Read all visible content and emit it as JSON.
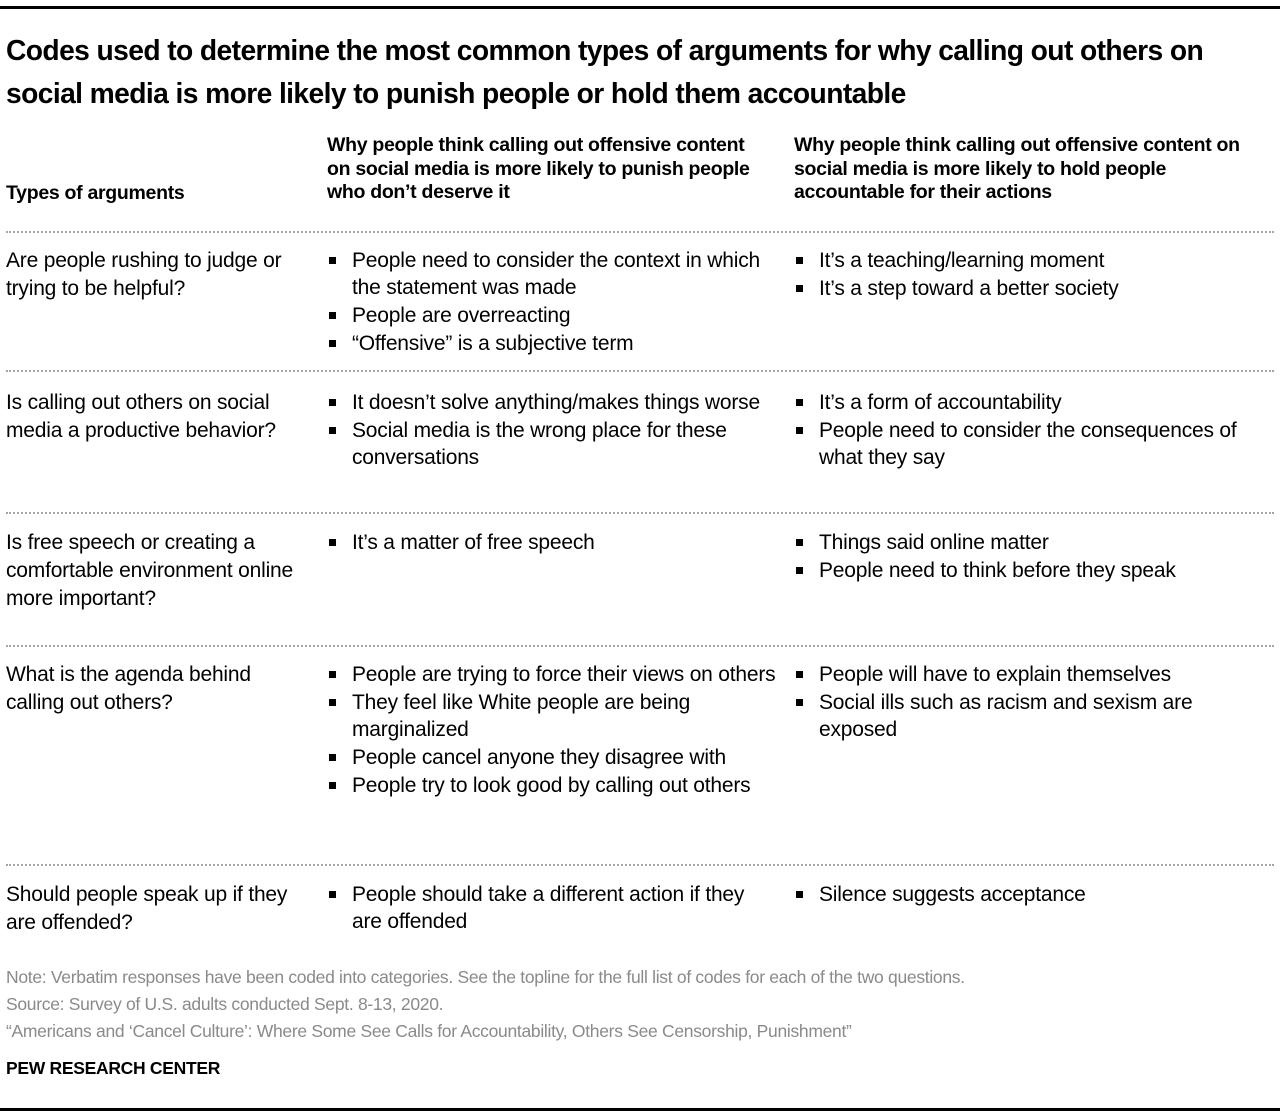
{
  "title": "Codes used to determine the most common types of arguments for why calling out others on social media is more likely to punish people or hold them accountable",
  "headers": {
    "types": "Types of arguments",
    "punish": "Why people think calling out offensive content on social media is more likely to punish people who don’t deserve it",
    "accountable": "Why people think calling out offensive content on social media is more likely to hold people accountable for their actions"
  },
  "rows": [
    {
      "type": "Are people rushing to judge or trying to be helpful?",
      "punish": [
        "People need to consider the context in which the statement was made",
        "People are overreacting",
        "“Offensive” is a subjective term"
      ],
      "accountable": [
        "It’s a teaching/learning moment",
        "It’s a step toward a better society"
      ]
    },
    {
      "type": "Is calling out others on social media a productive behavior?",
      "punish": [
        "It doesn’t solve anything/makes things worse",
        "Social media is the wrong place for these conversations"
      ],
      "accountable": [
        "It’s a form of accountability",
        "People need to consider the consequences of what they say"
      ]
    },
    {
      "type": "Is free speech or creating a comfortable environment online more important?",
      "punish": [
        "It’s a matter of free speech"
      ],
      "accountable": [
        "Things said online matter",
        "People need to think before they speak"
      ]
    },
    {
      "type": "What is the agenda behind calling out others?",
      "punish": [
        "People are trying to force their views on others",
        "They feel like White people are being marginalized",
        "People cancel anyone they disagree with",
        "People try to look good by calling out others"
      ],
      "accountable": [
        "People will have to explain themselves",
        "Social ills such as racism and sexism are exposed"
      ]
    },
    {
      "type": "Should people speak up if they are offended?",
      "punish": [
        "People should take a different action if they are offended"
      ],
      "accountable": [
        "Silence suggests acceptance"
      ]
    }
  ],
  "footer": {
    "note": "Note: Verbatim responses have been coded into categories. See the topline for the full list of codes for each of the two questions.",
    "source": "Source: Survey of U.S. adults conducted Sept. 8-13, 2020.",
    "report": "“Americans and ‘Cancel Culture’: Where Some See Calls for Accountability, Others See Censorship, Punishment”",
    "brand": "PEW RESEARCH CENTER"
  },
  "colors": {
    "text": "#000000",
    "note_text": "#8a8a8a",
    "divider": "#a6a6a6"
  }
}
